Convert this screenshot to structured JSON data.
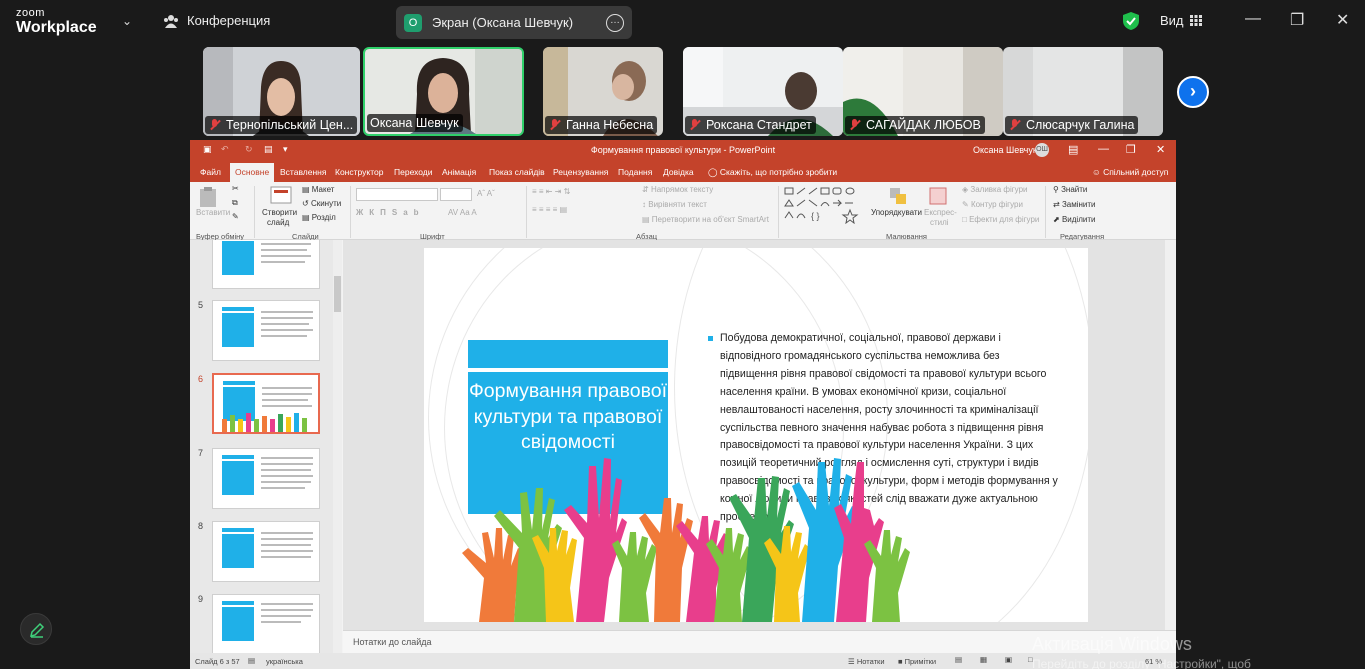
{
  "zoom": {
    "logo_line1": "zoom",
    "logo_line2": "Workplace",
    "conference_label": "Конференция",
    "screen_share_label": "Экран (Оксана Шевчук)",
    "screen_share_avatar": "О",
    "view_label": "Вид",
    "shield_color": "#1fbf4c",
    "accent_color": "#0e72ed"
  },
  "participants": [
    {
      "name": "Тернопільський Цен..."
    },
    {
      "name": "Оксана Шевчук"
    },
    {
      "name": "Ганна Небесна"
    },
    {
      "name": "Роксана Стандрет"
    },
    {
      "name": "САГАЙДАК ЛЮБОВ"
    },
    {
      "name": "Слюсарчук Галина"
    }
  ],
  "ppt": {
    "window_title": "Формування правової культури  -  PowerPoint",
    "user_name": "Оксана Шевчук",
    "user_initials": "ОШ",
    "tabs": [
      "Файл",
      "Основне",
      "Вставлення",
      "Конструктор",
      "Переходи",
      "Анімація",
      "Показ слайдів",
      "Рецензування",
      "Подання",
      "Довідка"
    ],
    "tell_me": "Скажіть, що потрібно зробити",
    "share": "Спільний доступ",
    "ribbon": {
      "paste": "Вставити",
      "clipboard": "Буфер обміну",
      "new_slide_1": "Створити",
      "new_slide_2": "слайд",
      "layout": "Макет",
      "reset": "Скинути",
      "sections": "Розділ",
      "slides": "Слайди",
      "font": "Шрифт",
      "text_direction": "Напрямок тексту",
      "align_text": "Вирівняти текст",
      "smartart": "Перетворити на об'єкт SmartArt",
      "paragraph": "Абзац",
      "arrange": "Упорядкувати",
      "quick_styles_1": "Експрес-",
      "quick_styles_2": "стилі",
      "shape_fill": "Заливка фігури",
      "shape_outline": "Контур фігури",
      "shape_effects": "Ефекти для фігури",
      "drawing": "Малювання",
      "find": "Знайти",
      "replace": "Замінити",
      "select": "Виділити",
      "editing": "Редагування"
    },
    "thumb_numbers": [
      "5",
      "6",
      "7",
      "8",
      "9"
    ],
    "slide": {
      "title": "Формування правової культури та правової свідомості",
      "body": "Побудова демократичної, соціальної, правової держави і відповідного громадянського суспільства неможлива без підвищення рівня правової свідомості та правової культури всього населення країни. В умовах економічної кризи, соціальної невлаштованості населення, росту злочинності та криміналізації суспільства певного значення набуває робота з підвищення рівня правосвідомості та правової культури населення України. З цих позицій теоретичний розгляд і осмислення суті, структури і видів правосвідомості та правової культури, форм і методів формування у кожної людини правових якостей слід вважати дуже актуальною проблемою.",
      "accent_color": "#1fb0e8"
    },
    "notes_label": "Нотатки до слайда",
    "status": {
      "slide_of": "Слайд 6 з 57",
      "language": "українська",
      "notes": "Нотатки",
      "comments": "Примітки",
      "zoom": "61 %"
    },
    "title_bar_color": "#c4432b"
  },
  "windows_activation": {
    "line1": "Активація Windows",
    "line2": "Перейдіть до розділу \"Настройки\", щоб"
  }
}
